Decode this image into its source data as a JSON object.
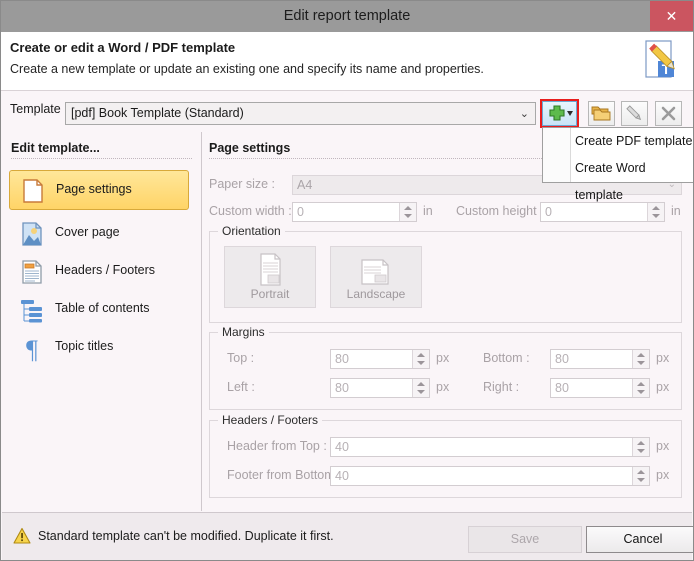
{
  "window": {
    "title": "Edit report template",
    "close_label": "✕"
  },
  "header": {
    "title": "Create or edit a Word / PDF template",
    "subtitle": "Create a new template or update an existing one and specify its name and properties.",
    "icon": "document-edit-text-icon"
  },
  "template_bar": {
    "label": "Template :",
    "selected_value": "[pdf] Book Template (Standard)",
    "chevron": "⌄",
    "buttons": [
      {
        "name": "add-template-button",
        "icon": "plus-icon",
        "caret": "▾",
        "highlighted": true
      },
      {
        "name": "duplicate-template-button",
        "icon": "folder-copy-icon"
      },
      {
        "name": "edit-template-button",
        "icon": "pencil-icon"
      },
      {
        "name": "delete-template-button",
        "icon": "x-icon"
      }
    ]
  },
  "dropdown_menu": {
    "open": true,
    "items": [
      {
        "label": "Create PDF template"
      },
      {
        "label": "Create Word template"
      }
    ]
  },
  "sidebar": {
    "heading": "Edit template...",
    "items": [
      {
        "label": "Page settings",
        "icon": "page-icon",
        "active": true
      },
      {
        "label": "Cover page",
        "icon": "image-page-icon",
        "active": false
      },
      {
        "label": "Headers / Footers",
        "icon": "header-footer-icon",
        "active": false
      },
      {
        "label": "Table of contents",
        "icon": "tree-list-icon",
        "active": false
      },
      {
        "label": "Topic titles",
        "icon": "pilcrow-icon",
        "active": false
      }
    ]
  },
  "main": {
    "heading": "Page settings",
    "paper_size": {
      "label": "Paper size :",
      "value": "A4",
      "chevron": "⌄"
    },
    "custom_width": {
      "label": "Custom width :",
      "value": "0",
      "unit": "in"
    },
    "custom_height": {
      "label": "Custom height :",
      "value": "0",
      "unit": "in"
    },
    "orientation": {
      "title": "Orientation",
      "options": [
        {
          "label": "Portrait",
          "icon": "portrait-page-icon"
        },
        {
          "label": "Landscape",
          "icon": "landscape-page-icon"
        }
      ]
    },
    "margins": {
      "title": "Margins",
      "fields": [
        {
          "label": "Top :",
          "value": "80",
          "unit": "px"
        },
        {
          "label": "Bottom :",
          "value": "80",
          "unit": "px"
        },
        {
          "label": "Left :",
          "value": "80",
          "unit": "px"
        },
        {
          "label": "Right :",
          "value": "80",
          "unit": "px"
        }
      ]
    },
    "headers_footers": {
      "title": "Headers / Footers",
      "fields": [
        {
          "label": "Header from Top :",
          "value": "40",
          "unit": "px"
        },
        {
          "label": "Footer from Bottom :",
          "value": "40",
          "unit": "px"
        }
      ]
    }
  },
  "bottom": {
    "warning_icon": "warning-triangle-icon",
    "warning_text": "Standard template can't be modified. Duplicate it first.",
    "save_label": "Save",
    "cancel_label": "Cancel"
  },
  "colors": {
    "titlebar": "#9a9a9a",
    "close_red": "#cb5560",
    "accent_yellow": "#ffd467",
    "highlight_red": "#e81d1d",
    "panel_bg": "#faf5f8"
  }
}
